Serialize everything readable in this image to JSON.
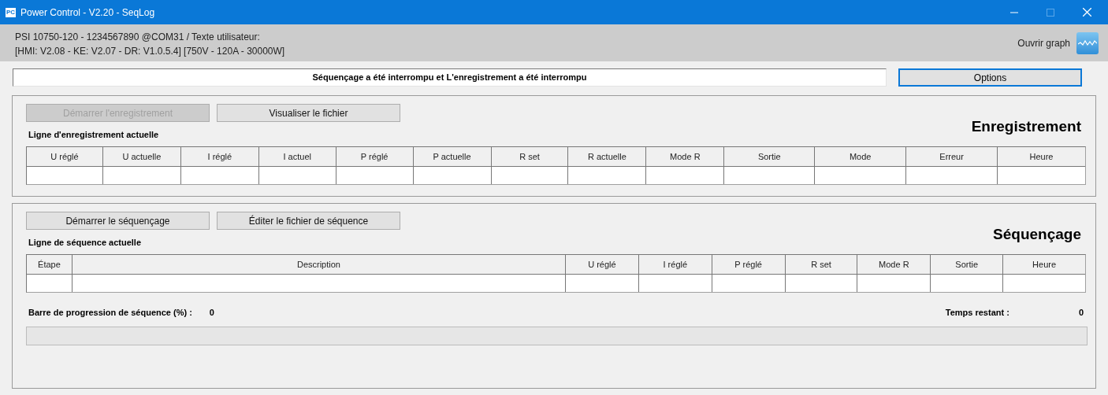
{
  "window": {
    "title": "Power Control - V2.20 - SeqLog",
    "app_icon_text": "PC"
  },
  "device_info": {
    "line_1": "PSI 10750-120 - 1234567890 @COM31 / Texte utilisateur:",
    "line_2": "[HMI: V2.08 - KE: V2.07 - DR: V1.0.5.4] [750V - 120A - 30000W]",
    "graph_label": "Ouvrir graph"
  },
  "status_message": "Séquençage a été interrompu et L'enregistrement a été interrompu",
  "options_button": "Options",
  "logging": {
    "title": "Enregistrement",
    "buttons": [
      {
        "label": "Démarrer l'enregistrement",
        "disabled": true
      },
      {
        "label": "Visualiser le fichier",
        "disabled": false
      }
    ],
    "table_label": "Ligne d'enregistrement actuelle",
    "columns": [
      "U réglé",
      "U actuelle",
      "I réglé",
      "I actuel",
      "P réglé",
      "P actuelle",
      "R set",
      "R actuelle",
      "Mode R",
      "Sortie",
      "Mode",
      "Erreur",
      "Heure"
    ]
  },
  "sequencing": {
    "title": "Séquençage",
    "buttons": [
      {
        "label": "Démarrer le séquençage",
        "disabled": false
      },
      {
        "label": "Éditer le fichier de séquence",
        "disabled": false
      }
    ],
    "table_label": "Ligne de séquence actuelle",
    "columns": [
      "Étape",
      "Description",
      "U réglé",
      "I réglé",
      "P réglé",
      "R set",
      "Mode R",
      "Sortie",
      "Heure"
    ],
    "progress_label": "Barre de progression de séquence (%) :",
    "progress_value": "0",
    "remaining_label": "Temps restant :",
    "remaining_value": "0",
    "progress": {
      "level": 0
    }
  }
}
